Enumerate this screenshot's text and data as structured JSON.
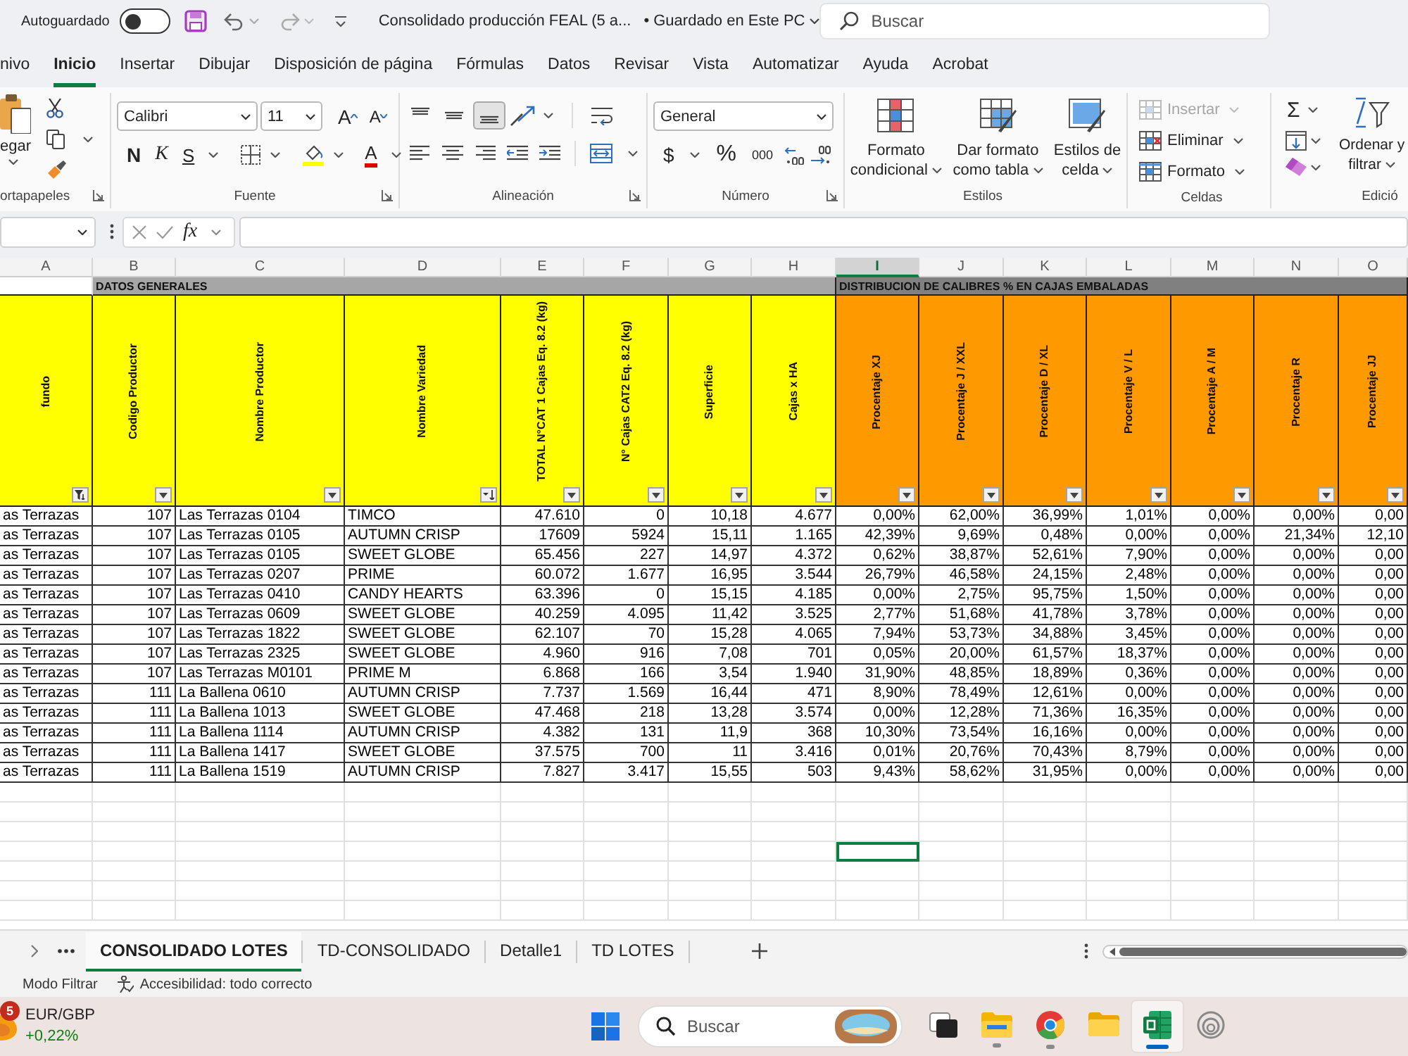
{
  "title_bar": {
    "autosave_label": "Autoguardado",
    "autosave_on": false,
    "document_title": "Consolidado producción FEAL (5 a...",
    "save_status": "• Guardado en Este PC",
    "search": {
      "placeholder": "Buscar"
    }
  },
  "menu_tabs": [
    {
      "label": "nivo",
      "selected": false
    },
    {
      "label": "Inicio",
      "selected": true
    },
    {
      "label": "Insertar",
      "selected": false
    },
    {
      "label": "Dibujar",
      "selected": false
    },
    {
      "label": "Disposición de página",
      "selected": false
    },
    {
      "label": "Fórmulas",
      "selected": false
    },
    {
      "label": "Datos",
      "selected": false
    },
    {
      "label": "Revisar",
      "selected": false
    },
    {
      "label": "Vista",
      "selected": false
    },
    {
      "label": "Automatizar",
      "selected": false
    },
    {
      "label": "Ayuda",
      "selected": false
    },
    {
      "label": "Acrobat",
      "selected": false
    }
  ],
  "ribbon": {
    "groups": [
      {
        "kind": "clipboard",
        "label": "ortapapeles",
        "launcher": true,
        "paste_label": "egar"
      },
      {
        "kind": "font",
        "label": "Fuente",
        "launcher": true,
        "font_name": "Calibri",
        "font_size": "11",
        "grow_glyph": "A",
        "shrink_glyph": "A",
        "bold_glyph": "N",
        "italic_glyph": "K",
        "underline_glyph": "S",
        "font_color_glyph": "A"
      },
      {
        "kind": "alignment",
        "label": "Alineación",
        "launcher": true,
        "vertical_align": [
          {
            "selected": false
          },
          {
            "selected": false
          },
          {
            "selected": true
          }
        ]
      },
      {
        "kind": "number",
        "label": "Número",
        "launcher": true,
        "format": "General",
        "currency_glyph": "$",
        "percent_glyph": "%",
        "thousands_glyph": "000"
      },
      {
        "kind": "styles",
        "label": "Estilos",
        "buttons": [
          {
            "kind": "conditional",
            "lines": [
              "Formato",
              "condicional"
            ]
          },
          {
            "kind": "table",
            "lines": [
              "Dar formato",
              "como tabla"
            ]
          },
          {
            "kind": "cell_styles",
            "lines": [
              "Estilos de",
              "celda"
            ]
          }
        ]
      },
      {
        "kind": "cells",
        "label": "Celdas",
        "buttons": [
          {
            "kind": "insert",
            "label": "Insertar",
            "disabled": true
          },
          {
            "kind": "delete",
            "label": "Eliminar",
            "disabled": false
          },
          {
            "kind": "format",
            "label": "Formato",
            "disabled": false
          }
        ]
      },
      {
        "kind": "editing",
        "label": "Edició",
        "sum_glyph": "Σ",
        "sort_lines": [
          "Ordenar y",
          "filtrar"
        ]
      }
    ]
  },
  "formula_bar": {
    "function_glyph": "fx"
  },
  "sheet": {
    "columns": [
      {
        "letter": "A",
        "title": "fundo",
        "color": "#ffff00",
        "filtered": true,
        "sorted": false,
        "selected": false
      },
      {
        "letter": "B",
        "title": "Codigo Productor",
        "color": "#ffff00",
        "filtered": false,
        "sorted": false,
        "selected": false
      },
      {
        "letter": "C",
        "title": "Nombre Productor",
        "color": "#ffff00",
        "filtered": false,
        "sorted": false,
        "selected": false
      },
      {
        "letter": "D",
        "title": "Nombre Variedad",
        "color": "#ffff00",
        "filtered": false,
        "sorted": true,
        "selected": false
      },
      {
        "letter": "E",
        "title": "TOTAL N°CAT 1 Cajas Eq. 8.2 (kg)",
        "color": "#ffff00",
        "filtered": false,
        "sorted": false,
        "selected": false
      },
      {
        "letter": "F",
        "title": "N° Cajas CAT2 Eq. 8.2 (kg)",
        "color": "#ffff00",
        "filtered": false,
        "sorted": false,
        "selected": false
      },
      {
        "letter": "G",
        "title": "Superficie",
        "color": "#ffff00",
        "filtered": false,
        "sorted": false,
        "selected": false
      },
      {
        "letter": "H",
        "title": "Cajas x HA",
        "color": "#ffff00",
        "filtered": false,
        "sorted": false,
        "selected": false
      },
      {
        "letter": "I",
        "title": "Procentaje XJ",
        "color": "#ff9900",
        "filtered": false,
        "sorted": false,
        "selected": true
      },
      {
        "letter": "J",
        "title": "Procentaje J / XXL",
        "color": "#ff9900",
        "filtered": false,
        "sorted": false,
        "selected": false
      },
      {
        "letter": "K",
        "title": "Procentaje D / XL",
        "color": "#ff9900",
        "filtered": false,
        "sorted": false,
        "selected": false
      },
      {
        "letter": "L",
        "title": "Procentaje V / L",
        "color": "#ff9900",
        "filtered": false,
        "sorted": false,
        "selected": false
      },
      {
        "letter": "M",
        "title": "Procentaje A / M",
        "color": "#ff9900",
        "filtered": false,
        "sorted": false,
        "selected": false
      },
      {
        "letter": "N",
        "title": "Procentaje R",
        "color": "#ff9900",
        "filtered": false,
        "sorted": false,
        "selected": false
      },
      {
        "letter": "O",
        "title": "Procentaje JJ",
        "color": "#ff9900",
        "filtered": false,
        "sorted": false,
        "selected": false
      }
    ],
    "bands": [
      {
        "label": "DATOS GENERALES",
        "color": "#a6a6a6"
      },
      {
        "label": "DISTRIBUCION DE CALIBRES % EN CAJAS EMBALADAS",
        "color": "#808080"
      }
    ],
    "rows": [
      {
        "cells": [
          "as Terrazas",
          "107",
          "Las Terrazas 0104",
          "TIMCO",
          "47.610",
          "0",
          "10,18",
          "4.677",
          "0,00%",
          "62,00%",
          "36,99%",
          "1,01%",
          "0,00%",
          "0,00%",
          "0,00"
        ]
      },
      {
        "cells": [
          "as Terrazas",
          "107",
          "Las Terrazas 0105",
          "AUTUMN CRISP",
          "17609",
          "5924",
          "15,11",
          "1.165",
          "42,39%",
          "9,69%",
          "0,48%",
          "0,00%",
          "0,00%",
          "21,34%",
          "12,10"
        ]
      },
      {
        "cells": [
          "as Terrazas",
          "107",
          "Las Terrazas 0105",
          "SWEET GLOBE",
          "65.456",
          "227",
          "14,97",
          "4.372",
          "0,62%",
          "38,87%",
          "52,61%",
          "7,90%",
          "0,00%",
          "0,00%",
          "0,00"
        ]
      },
      {
        "cells": [
          "as Terrazas",
          "107",
          "Las Terrazas 0207",
          "PRIME",
          "60.072",
          "1.677",
          "16,95",
          "3.544",
          "26,79%",
          "46,58%",
          "24,15%",
          "2,48%",
          "0,00%",
          "0,00%",
          "0,00"
        ]
      },
      {
        "cells": [
          "as Terrazas",
          "107",
          "Las Terrazas 0410",
          "CANDY HEARTS",
          "63.396",
          "0",
          "15,15",
          "4.185",
          "0,00%",
          "2,75%",
          "95,75%",
          "1,50%",
          "0,00%",
          "0,00%",
          "0,00"
        ]
      },
      {
        "cells": [
          "as Terrazas",
          "107",
          "Las Terrazas 0609",
          "SWEET GLOBE",
          "40.259",
          "4.095",
          "11,42",
          "3.525",
          "2,77%",
          "51,68%",
          "41,78%",
          "3,78%",
          "0,00%",
          "0,00%",
          "0,00"
        ]
      },
      {
        "cells": [
          "as Terrazas",
          "107",
          "Las Terrazas 1822",
          "SWEET GLOBE",
          "62.107",
          "70",
          "15,28",
          "4.065",
          "7,94%",
          "53,73%",
          "34,88%",
          "3,45%",
          "0,00%",
          "0,00%",
          "0,00"
        ]
      },
      {
        "cells": [
          "as Terrazas",
          "107",
          "Las Terrazas 2325",
          "SWEET GLOBE",
          "4.960",
          "916",
          "7,08",
          "701",
          "0,05%",
          "20,00%",
          "61,57%",
          "18,37%",
          "0,00%",
          "0,00%",
          "0,00"
        ]
      },
      {
        "cells": [
          "as Terrazas",
          "107",
          "Las Terrazas M0101",
          "PRIME M",
          "6.868",
          "166",
          "3,54",
          "1.940",
          "31,90%",
          "48,85%",
          "18,89%",
          "0,36%",
          "0,00%",
          "0,00%",
          "0,00"
        ]
      },
      {
        "cells": [
          "as Terrazas",
          "111",
          "La Ballena 0610",
          "AUTUMN CRISP",
          "7.737",
          "1.569",
          "16,44",
          "471",
          "8,90%",
          "78,49%",
          "12,61%",
          "0,00%",
          "0,00%",
          "0,00%",
          "0,00"
        ]
      },
      {
        "cells": [
          "as Terrazas",
          "111",
          "La Ballena 1013",
          "SWEET GLOBE",
          "47.468",
          "218",
          "13,28",
          "3.574",
          "0,00%",
          "12,28%",
          "71,36%",
          "16,35%",
          "0,00%",
          "0,00%",
          "0,00"
        ]
      },
      {
        "cells": [
          "as Terrazas",
          "111",
          "La Ballena 1114",
          "AUTUMN CRISP",
          "4.382",
          "131",
          "11,9",
          "368",
          "10,30%",
          "73,54%",
          "16,16%",
          "0,00%",
          "0,00%",
          "0,00%",
          "0,00"
        ]
      },
      {
        "cells": [
          "as Terrazas",
          "111",
          "La Ballena 1417",
          "SWEET GLOBE",
          "37.575",
          "700",
          "11",
          "3.416",
          "0,01%",
          "20,76%",
          "70,43%",
          "8,79%",
          "0,00%",
          "0,00%",
          "0,00"
        ]
      },
      {
        "cells": [
          "as Terrazas",
          "111",
          "La Ballena 1519",
          "AUTUMN CRISP",
          "7.827",
          "3.417",
          "15,55",
          "503",
          "9,43%",
          "58,62%",
          "31,95%",
          "0,00%",
          "0,00%",
          "0,00%",
          "0,00"
        ]
      }
    ],
    "blank_rows": [
      {
        "selected": false
      },
      {
        "selected": false
      },
      {
        "selected": false
      },
      {
        "selected": true
      },
      {
        "selected": false
      },
      {
        "selected": false
      },
      {
        "selected": false
      }
    ]
  },
  "sheet_tabs": [
    {
      "label": "CONSOLIDADO LOTES",
      "selected": true
    },
    {
      "label": "TD-CONSOLIDADO",
      "selected": false
    },
    {
      "label": "Detalle1",
      "selected": false
    },
    {
      "label": "TD LOTES",
      "selected": false
    }
  ],
  "status_bar": {
    "mode": "Modo Filtrar",
    "accessibility": "Accesibilidad: todo correcto"
  },
  "taskbar": {
    "widget": {
      "badge": "5",
      "title": "EUR/GBP",
      "change": "+0,22%"
    },
    "search": {
      "placeholder": "Buscar"
    },
    "apps": [
      {
        "kind": "task_view",
        "running": false,
        "selected": false
      },
      {
        "kind": "file_explorer",
        "running": true,
        "selected": false
      },
      {
        "kind": "browser",
        "running": true,
        "selected": false
      },
      {
        "kind": "folder",
        "running": false,
        "selected": false
      },
      {
        "kind": "spreadsheet",
        "running": true,
        "selected": true
      },
      {
        "kind": "ring",
        "running": false,
        "selected": false
      }
    ]
  }
}
